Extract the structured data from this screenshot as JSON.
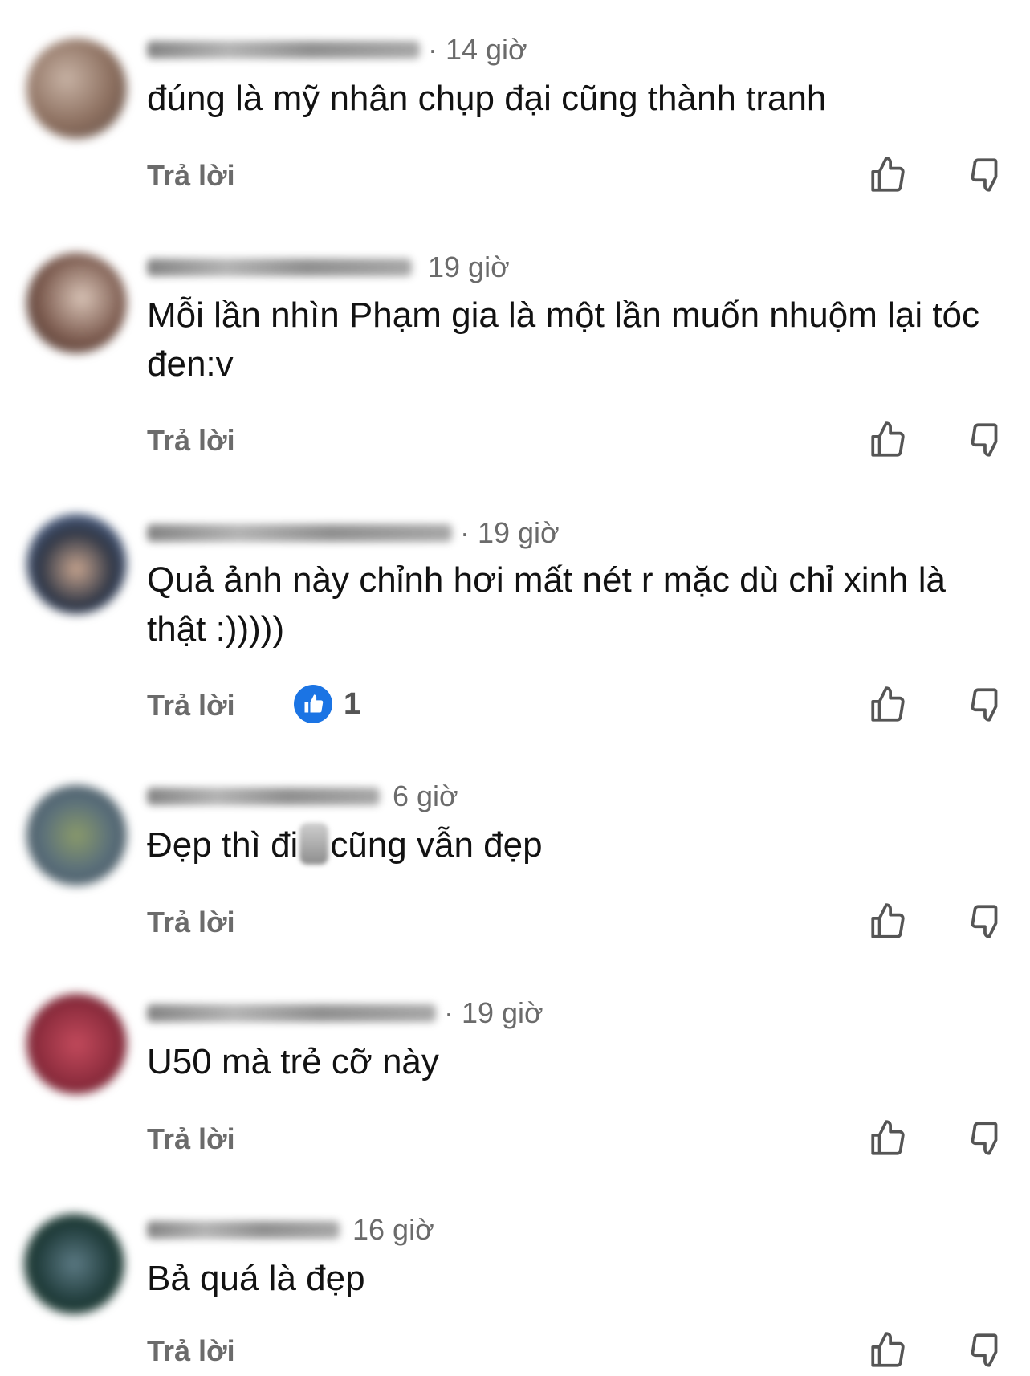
{
  "reply_label": "Trả lời",
  "comments": [
    {
      "time": "· 14 giờ",
      "text": "đúng là mỹ nhân chụp đại cũng thành tranh",
      "avatar_colors": [
        "#8b6e5e",
        "#c7b2a4",
        "#5a4a44"
      ]
    },
    {
      "time": "19 giờ",
      "text": "Mỗi lần nhìn Phạm gia là một lần muốn nhuộm lại tóc đen:v",
      "avatar_colors": [
        "#3b2a26",
        "#d8c3b6",
        "#7b5a4e"
      ]
    },
    {
      "time": "· 19 giờ",
      "text": "Quả ảnh này chỉnh hơi mất nét r mặc dù chỉ xinh là thật :)))))",
      "avatar_colors": [
        "#6f8fc9",
        "#2f3645",
        "#c8a58f"
      ],
      "likes": "1"
    },
    {
      "time": "6 giờ",
      "text_before": "Đẹp thì đi",
      "text_after": "cũng vẫn đẹp",
      "avatar_colors": [
        "#5a6f7b",
        "#8a9a6a",
        "#3e4a52"
      ]
    },
    {
      "time": "· 19 giờ",
      "text": "U50 mà trẻ cỡ này",
      "avatar_colors": [
        "#8e2d3e",
        "#c24a5c",
        "#5e1a26"
      ]
    },
    {
      "time": "16 giờ",
      "text": "Bả quá là đẹp",
      "avatar_colors": [
        "#1f3b3a",
        "#5c7a84",
        "#2d4a36"
      ]
    }
  ]
}
